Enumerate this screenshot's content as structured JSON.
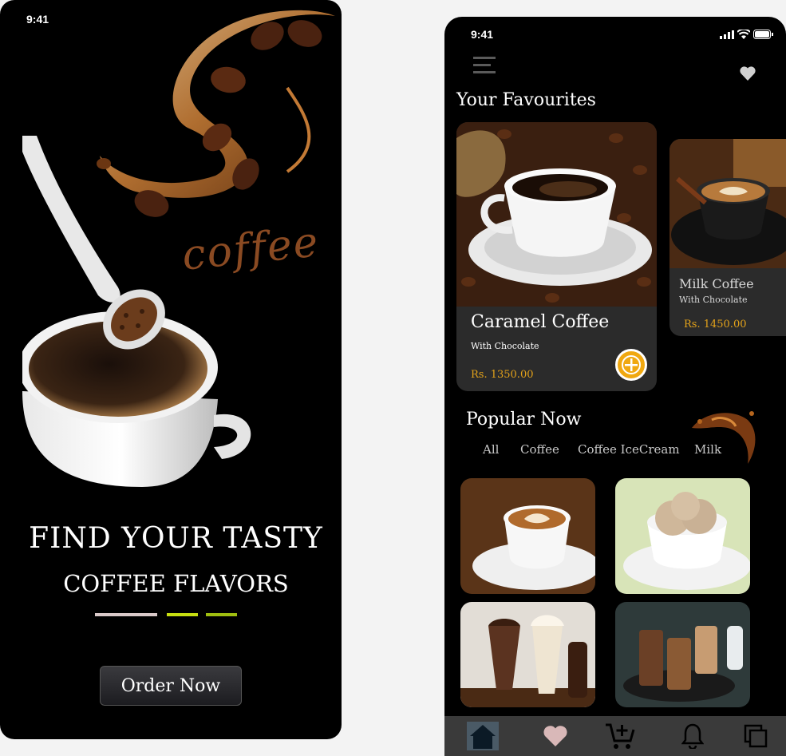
{
  "left_screen": {
    "status_time": "9:41",
    "script_word": "coffee",
    "headline_line1": "FIND YOUR TASTY",
    "headline_line2": "COFFEE FLAVORS",
    "cta_label": "Order Now",
    "pager": {
      "count": 3,
      "active_index": 0
    }
  },
  "right_screen": {
    "status_time": "9:41",
    "favourites_title": "Your Favourites",
    "favourites": [
      {
        "name": "Caramel Coffee",
        "subtitle": "With Chocolate",
        "price": "Rs. 1350.00"
      },
      {
        "name": "Milk Coffee",
        "subtitle": "With Chocolate",
        "price": "Rs. 1450.00"
      }
    ],
    "popular_title": "Popular Now",
    "categories": [
      "All",
      "Coffee",
      "Coffee IceCream",
      "Milk"
    ],
    "popular_items": [
      "latte",
      "ice-cream",
      "milkshake",
      "iced-coffee"
    ],
    "bottom_nav": [
      "home-icon",
      "heart-icon",
      "cart-add-icon",
      "bell-icon",
      "copy-icon"
    ]
  },
  "colors": {
    "background": "#000000",
    "card": "#2b2b2b",
    "accent_price": "#e3a21a",
    "add_button": "#f0a810",
    "pager_active": "#d9c9c9",
    "pager_inactive": "#b8d10e",
    "bottom_bar": "#3a3a3a",
    "heart": "#d9b8b8"
  }
}
